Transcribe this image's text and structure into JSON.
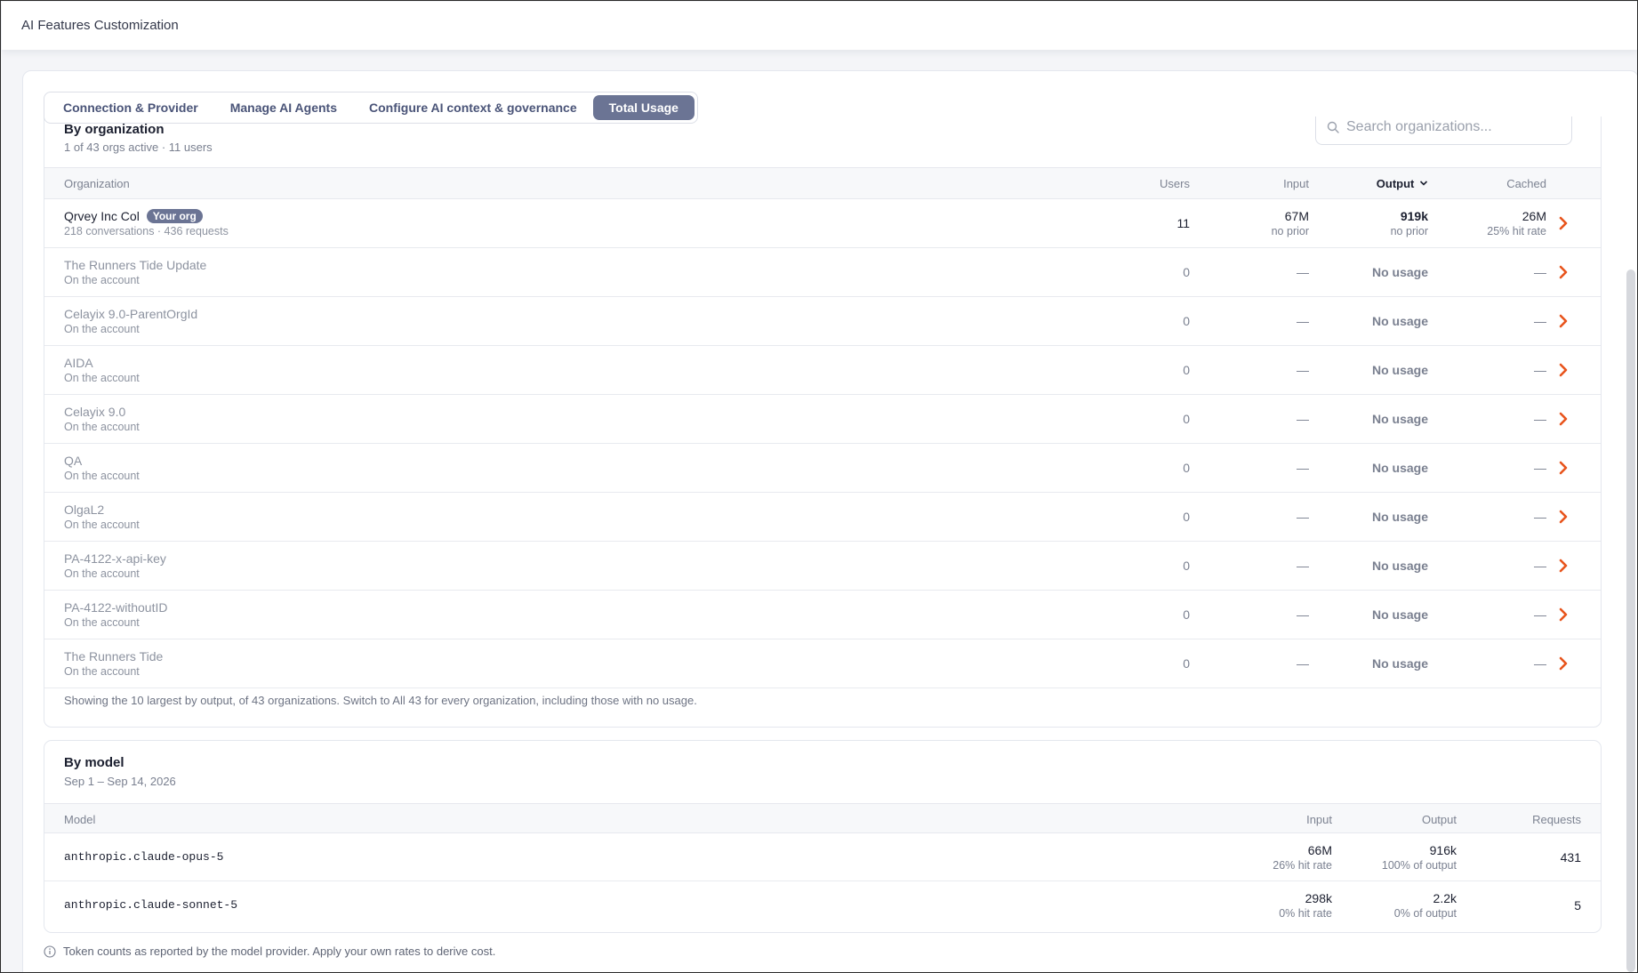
{
  "header": {
    "title": "AI Features Customization"
  },
  "tabs": [
    {
      "label": "Connection & Provider"
    },
    {
      "label": "Manage AI Agents"
    },
    {
      "label": "Configure AI context & governance"
    },
    {
      "label": "Total Usage"
    }
  ],
  "by_org": {
    "title": "By organization",
    "subtitle": "1 of 43 orgs active · 11 users",
    "search_placeholder": "Search organizations...",
    "columns": {
      "org": "Organization",
      "users": "Users",
      "input": "Input",
      "output": "Output",
      "cached": "Cached"
    },
    "top_row": {
      "name": "Qrvey Inc Col",
      "badge": "Your org",
      "meta": "218 conversations · 436 requests",
      "users": "11",
      "input": "67M",
      "input_sub": "no prior",
      "output": "919k",
      "output_sub": "no prior",
      "cached": "26M",
      "cached_sub": "25% hit rate"
    },
    "rows": [
      {
        "name": "The Runners Tide Update",
        "meta": "On the account",
        "users": "0",
        "input": "—",
        "output": "No usage",
        "cached": "—"
      },
      {
        "name": "Celayix 9.0-ParentOrgId",
        "meta": "On the account",
        "users": "0",
        "input": "—",
        "output": "No usage",
        "cached": "—"
      },
      {
        "name": "AIDA",
        "meta": "On the account",
        "users": "0",
        "input": "—",
        "output": "No usage",
        "cached": "—"
      },
      {
        "name": "Celayix 9.0",
        "meta": "On the account",
        "users": "0",
        "input": "—",
        "output": "No usage",
        "cached": "—"
      },
      {
        "name": "QA",
        "meta": "On the account",
        "users": "0",
        "input": "—",
        "output": "No usage",
        "cached": "—"
      },
      {
        "name": "OlgaL2",
        "meta": "On the account",
        "users": "0",
        "input": "—",
        "output": "No usage",
        "cached": "—"
      },
      {
        "name": "PA-4122-x-api-key",
        "meta": "On the account",
        "users": "0",
        "input": "—",
        "output": "No usage",
        "cached": "—"
      },
      {
        "name": "PA-4122-withoutID",
        "meta": "On the account",
        "users": "0",
        "input": "—",
        "output": "No usage",
        "cached": "—"
      },
      {
        "name": "The Runners Tide",
        "meta": "On the account",
        "users": "0",
        "input": "—",
        "output": "No usage",
        "cached": "—"
      }
    ],
    "footnote": "Showing the 10 largest by output, of 43 organizations. Switch to All 43 for every organization, including those with no usage."
  },
  "by_model": {
    "title": "By model",
    "subtitle": "Sep 1 – Sep 14, 2026",
    "columns": {
      "model": "Model",
      "input": "Input",
      "output": "Output",
      "requests": "Requests"
    },
    "rows": [
      {
        "model": "anthropic.claude-opus-5",
        "input": "66M",
        "input_sub": "26% hit rate",
        "output": "916k",
        "output_sub": "100% of output",
        "requests": "431"
      },
      {
        "model": "anthropic.claude-sonnet-5",
        "input": "298k",
        "input_sub": "0% hit rate",
        "output": "2.2k",
        "output_sub": "0% of output",
        "requests": "5"
      }
    ]
  },
  "info_note": "Token counts as reported by the model provider. Apply your own rates to derive cost.",
  "colors": {
    "accent": "#6b7494",
    "chevron": "#e8541c"
  }
}
